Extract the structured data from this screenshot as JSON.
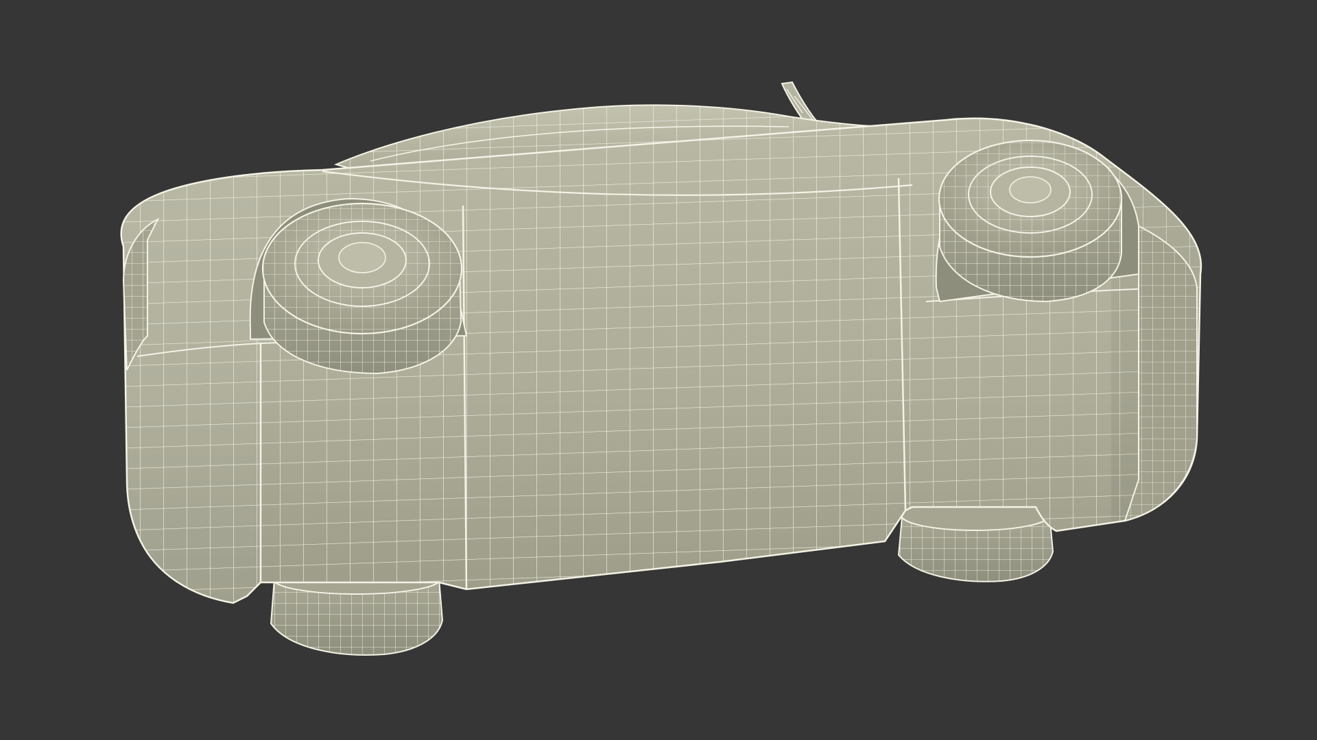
{
  "viewport": {
    "background_color": "#363636"
  },
  "model": {
    "subject": "car-wireframe-underside",
    "surface_color": "#ADAD99",
    "surface_shade_color": "#979784",
    "surface_highlight_color": "#C4C4B2",
    "wire_color": "#F4F3E6",
    "shadow_color": "#5E5E52"
  }
}
